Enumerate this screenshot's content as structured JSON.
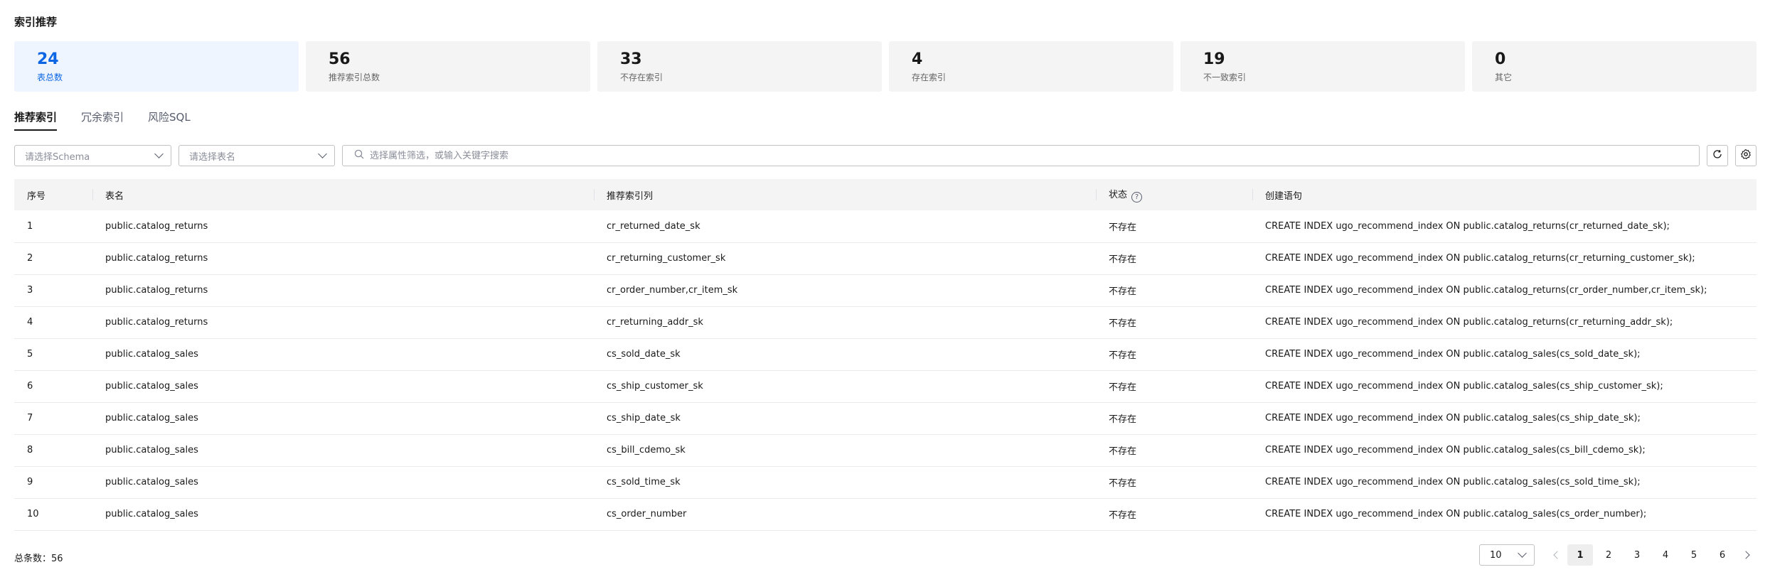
{
  "page": {
    "title": "索引推荐"
  },
  "stats": [
    {
      "value": "24",
      "label": "表总数",
      "active": true
    },
    {
      "value": "56",
      "label": "推荐索引总数"
    },
    {
      "value": "33",
      "label": "不存在索引"
    },
    {
      "value": "4",
      "label": "存在索引"
    },
    {
      "value": "19",
      "label": "不一致索引"
    },
    {
      "value": "0",
      "label": "其它"
    }
  ],
  "tabs": [
    {
      "label": "推荐索引",
      "active": true
    },
    {
      "label": "冗余索引"
    },
    {
      "label": "风险SQL"
    }
  ],
  "filters": {
    "schema_placeholder": "请选择Schema",
    "table_placeholder": "请选择表名",
    "search_placeholder": "选择属性筛选，或输入关键字搜索"
  },
  "table": {
    "columns": [
      "序号",
      "表名",
      "推荐索引列",
      "状态",
      "创建语句"
    ],
    "rows": [
      [
        "1",
        "public.catalog_returns",
        "cr_returned_date_sk",
        "不存在",
        "CREATE INDEX ugo_recommend_index ON public.catalog_returns(cr_returned_date_sk);"
      ],
      [
        "2",
        "public.catalog_returns",
        "cr_returning_customer_sk",
        "不存在",
        "CREATE INDEX ugo_recommend_index ON public.catalog_returns(cr_returning_customer_sk);"
      ],
      [
        "3",
        "public.catalog_returns",
        "cr_order_number,cr_item_sk",
        "不存在",
        "CREATE INDEX ugo_recommend_index ON public.catalog_returns(cr_order_number,cr_item_sk);"
      ],
      [
        "4",
        "public.catalog_returns",
        "cr_returning_addr_sk",
        "不存在",
        "CREATE INDEX ugo_recommend_index ON public.catalog_returns(cr_returning_addr_sk);"
      ],
      [
        "5",
        "public.catalog_sales",
        "cs_sold_date_sk",
        "不存在",
        "CREATE INDEX ugo_recommend_index ON public.catalog_sales(cs_sold_date_sk);"
      ],
      [
        "6",
        "public.catalog_sales",
        "cs_ship_customer_sk",
        "不存在",
        "CREATE INDEX ugo_recommend_index ON public.catalog_sales(cs_ship_customer_sk);"
      ],
      [
        "7",
        "public.catalog_sales",
        "cs_ship_date_sk",
        "不存在",
        "CREATE INDEX ugo_recommend_index ON public.catalog_sales(cs_ship_date_sk);"
      ],
      [
        "8",
        "public.catalog_sales",
        "cs_bill_cdemo_sk",
        "不存在",
        "CREATE INDEX ugo_recommend_index ON public.catalog_sales(cs_bill_cdemo_sk);"
      ],
      [
        "9",
        "public.catalog_sales",
        "cs_sold_time_sk",
        "不存在",
        "CREATE INDEX ugo_recommend_index ON public.catalog_sales(cs_sold_time_sk);"
      ],
      [
        "10",
        "public.catalog_sales",
        "cs_order_number",
        "不存在",
        "CREATE INDEX ugo_recommend_index ON public.catalog_sales(cs_order_number);"
      ]
    ]
  },
  "footer": {
    "total_text": "总条数：56",
    "page_size": "10",
    "pages": [
      "1",
      "2",
      "3",
      "4",
      "5",
      "6"
    ],
    "current_page": "1"
  },
  "colors": {
    "accent": "#0c66e4",
    "active_card_bg": "#eef5fe",
    "card_bg": "#f4f4f4"
  }
}
